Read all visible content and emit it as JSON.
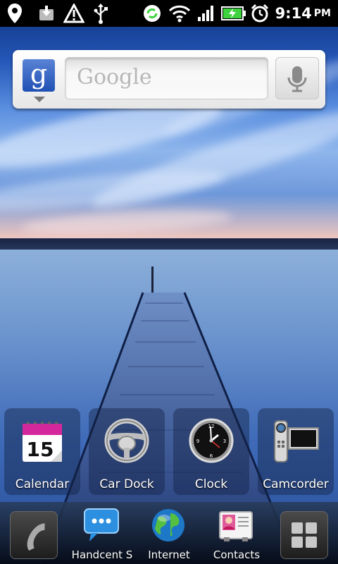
{
  "status_bar": {
    "time": "9:14",
    "ampm": "PM",
    "icons": [
      "location-pin-icon",
      "download-icon",
      "warning-icon",
      "usb-icon",
      "sync-icon",
      "wifi-icon",
      "signal-icon",
      "battery-charging-icon",
      "alarm-icon"
    ]
  },
  "search_widget": {
    "provider_logo": "g",
    "placeholder": "Google",
    "mic_icon": "microphone-icon"
  },
  "apps": [
    {
      "label": "Calendar",
      "icon": "calendar-icon",
      "day": "15"
    },
    {
      "label": "Car Dock",
      "icon": "steering-wheel-icon"
    },
    {
      "label": "Clock",
      "icon": "clock-icon"
    },
    {
      "label": "Camcorder",
      "icon": "camcorder-icon"
    }
  ],
  "dock": {
    "phone_icon": "phone-icon",
    "apps": [
      {
        "label": "Handcent S",
        "icon": "message-bubble-icon"
      },
      {
        "label": "Internet",
        "icon": "globe-icon"
      },
      {
        "label": "Contacts",
        "icon": "contacts-card-icon"
      }
    ],
    "launcher_icon": "app-grid-icon"
  },
  "colors": {
    "status_bar_bg": "#000000",
    "accent_battery": "#3fd23f",
    "google_blue": "#1e4fb3"
  }
}
